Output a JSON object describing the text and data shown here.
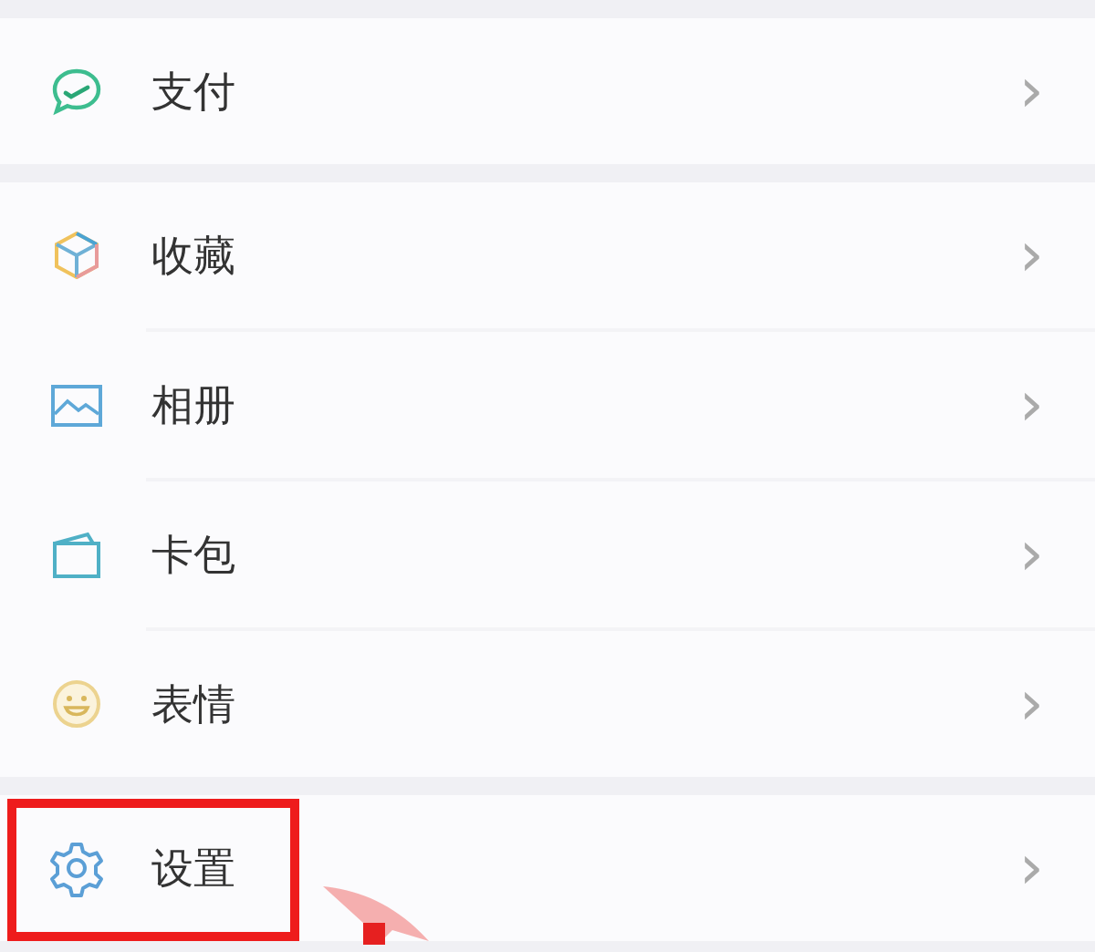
{
  "groups": [
    {
      "items": [
        {
          "kind": "pay",
          "label": "支付",
          "highlighted": false,
          "chevron": "›"
        }
      ]
    },
    {
      "items": [
        {
          "kind": "favorites",
          "label": "收藏",
          "highlighted": false,
          "chevron": "›"
        },
        {
          "kind": "album",
          "label": "相册",
          "highlighted": false,
          "chevron": "›"
        },
        {
          "kind": "cards",
          "label": "卡包",
          "highlighted": false,
          "chevron": "›"
        },
        {
          "kind": "stickers",
          "label": "表情",
          "highlighted": false,
          "chevron": "›"
        }
      ]
    },
    {
      "items": [
        {
          "kind": "settings",
          "label": "设置",
          "highlighted": true,
          "chevron": "›"
        }
      ]
    }
  ]
}
